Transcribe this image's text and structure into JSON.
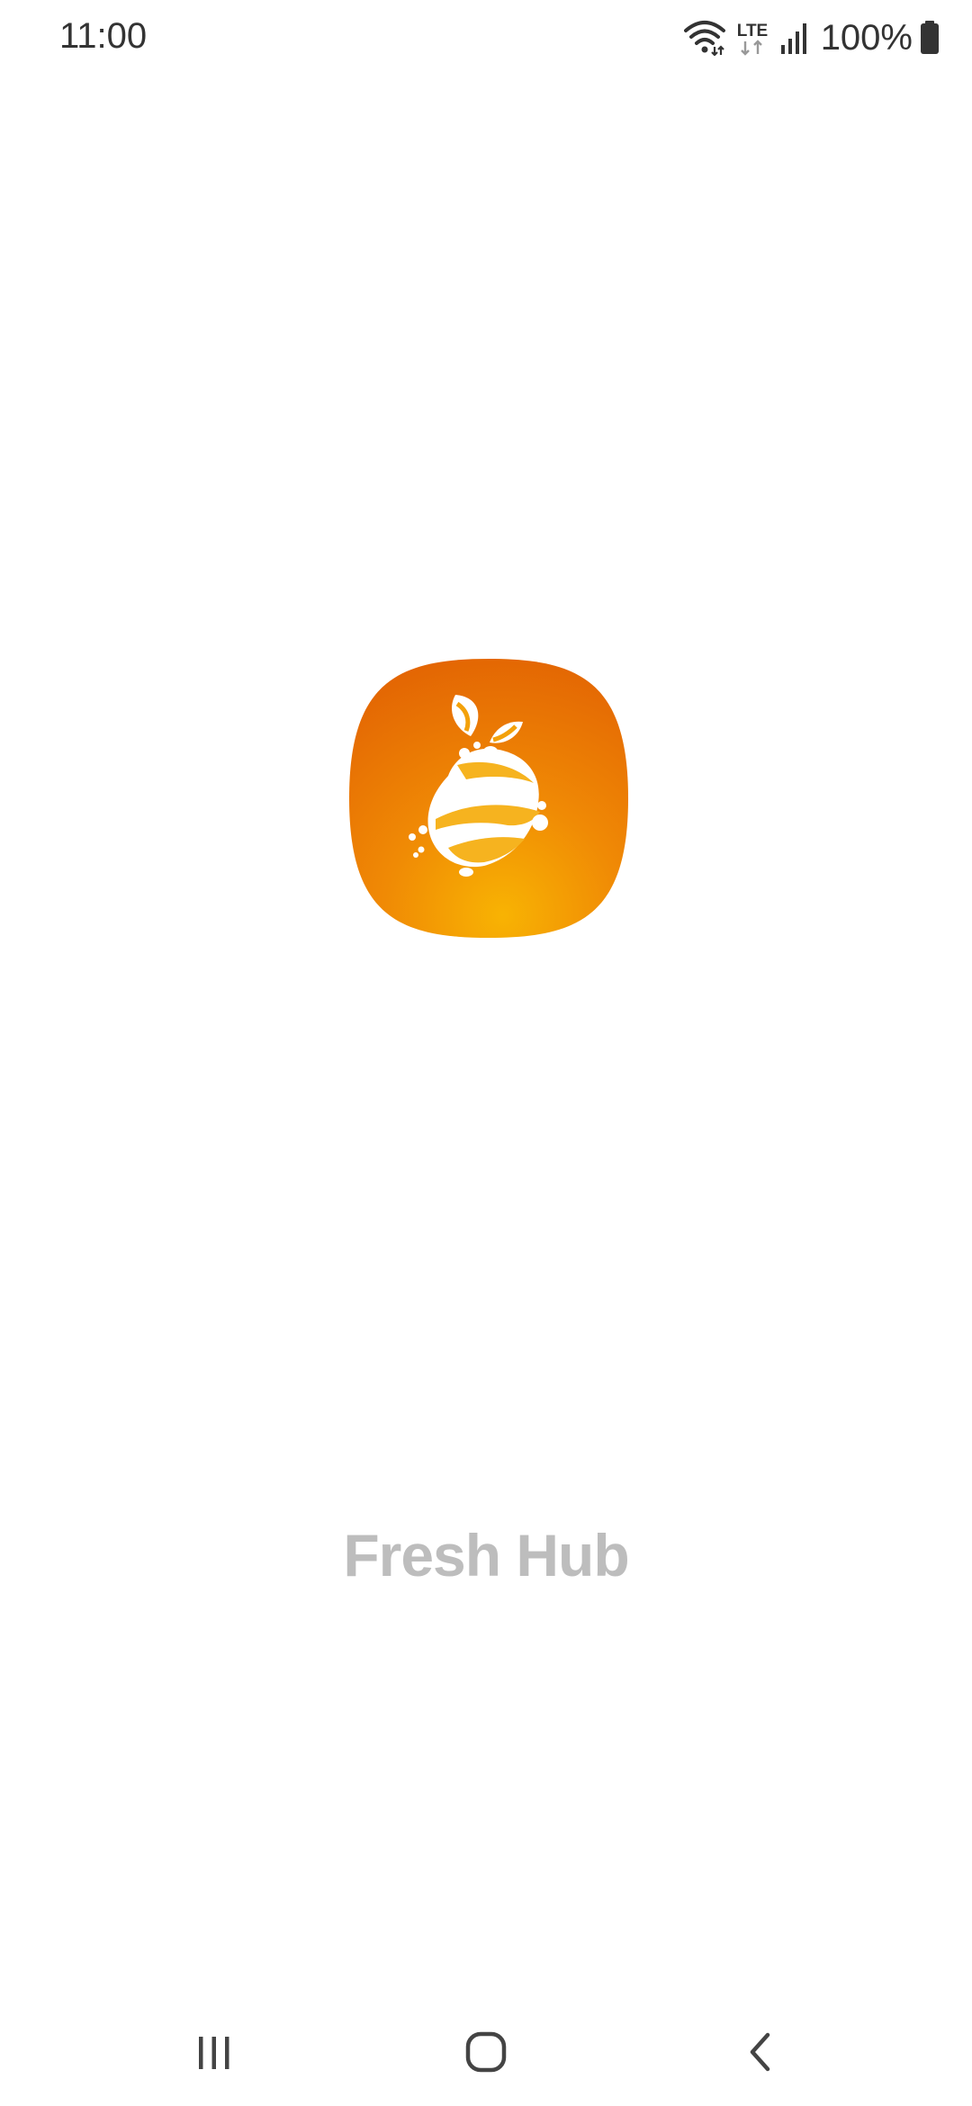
{
  "status_bar": {
    "time": "11:00",
    "network": "LTE",
    "battery": "100%",
    "icons": [
      "wifi-icon",
      "lte-icon",
      "signal-icon",
      "battery-icon"
    ]
  },
  "splash": {
    "app_name": "Fresh Hub",
    "icon": "fresh-hub-logo-icon",
    "colors": {
      "icon_dark_orange": "#e56a03",
      "icon_light_orange": "#f6a404",
      "app_name_text": "#bdbdbd"
    }
  },
  "nav_bar": {
    "items": [
      "recents-icon",
      "home-icon",
      "back-icon"
    ]
  }
}
